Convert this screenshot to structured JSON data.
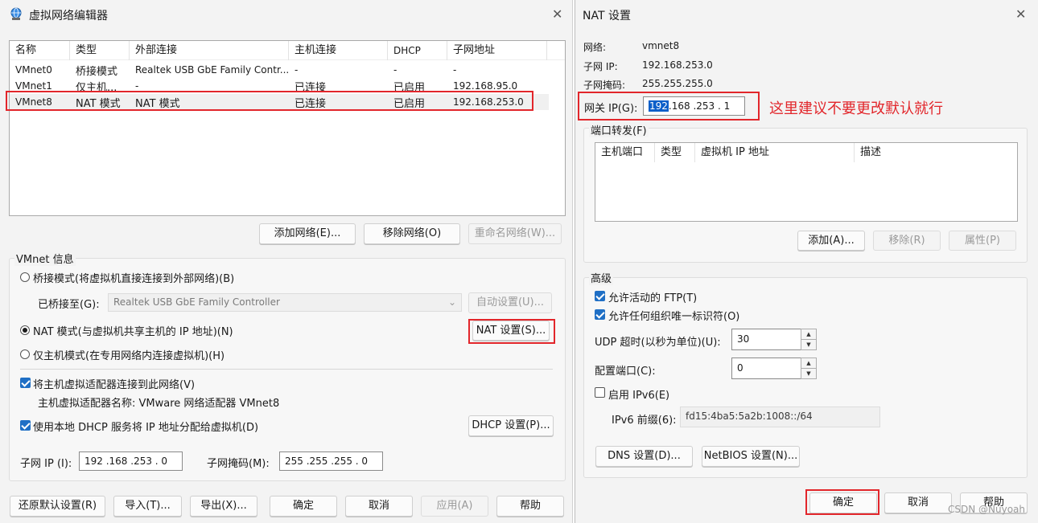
{
  "left": {
    "title": "虚拟网络编辑器",
    "columns": [
      "名称",
      "类型",
      "外部连接",
      "主机连接",
      "DHCP",
      "子网地址"
    ],
    "rows": [
      [
        "VMnet0",
        "桥接模式",
        "Realtek USB GbE Family Contr...",
        "-",
        "-",
        "-"
      ],
      [
        "VMnet1",
        "仅主机...",
        "-",
        "已连接",
        "已启用",
        "192.168.95.0"
      ],
      [
        "VMnet8",
        "NAT 模式",
        "NAT 模式",
        "已连接",
        "已启用",
        "192.168.253.0"
      ]
    ],
    "buttons": {
      "add_network": "添加网络(E)...",
      "remove_network": "移除网络(O)",
      "rename_network": "重命名网络(W)..."
    },
    "info_group": "VMnet 信息",
    "bridged_radio": "桥接模式(将虚拟机直接连接到外部网络)(B)",
    "bridged_to_label": "已桥接至(G):",
    "bridged_to_value": "Realtek USB GbE Family Controller",
    "auto_settings": "自动设置(U)...",
    "nat_radio": "NAT 模式(与虚拟机共享主机的 IP 地址)(N)",
    "nat_settings": "NAT 设置(S)...",
    "hostonly_radio": "仅主机模式(在专用网络内连接虚拟机)(H)",
    "connect_adapter": "将主机虚拟适配器连接到此网络(V)",
    "adapter_name": "主机虚拟适配器名称: VMware 网络适配器 VMnet8",
    "use_dhcp": "使用本地 DHCP 服务将 IP 地址分配给虚拟机(D)",
    "dhcp_settings": "DHCP 设置(P)...",
    "subnet_ip_label": "子网 IP (I):",
    "subnet_ip_value": "192 .168 .253 .  0",
    "subnet_mask_label": "子网掩码(M):",
    "subnet_mask_value": "255 .255 .255 .  0",
    "footer": {
      "restore": "还原默认设置(R)",
      "import": "导入(T)...",
      "export": "导出(X)...",
      "ok": "确定",
      "cancel": "取消",
      "apply": "应用(A)",
      "help": "帮助"
    }
  },
  "right": {
    "title": "NAT 设置",
    "network_label": "网络:",
    "network_value": "vmnet8",
    "subnet_ip_label": "子网 IP:",
    "subnet_ip_value": "192.168.253.0",
    "subnet_mask_label": "子网掩码:",
    "subnet_mask_value": "255.255.255.0",
    "gateway_label": "网关 IP(G):",
    "gateway_sel": "192",
    "gateway_rest": ".168 .253 .  1",
    "annotation": "这里建议不要更改默认就行",
    "port_forward_group": "端口转发(F)",
    "pf_columns": [
      "主机端口",
      "类型",
      "虚拟机 IP 地址",
      "描述"
    ],
    "pf_buttons": {
      "add": "添加(A)...",
      "remove": "移除(R)",
      "props": "属性(P)"
    },
    "advanced_group": "高级",
    "allow_ftp": "允许活动的 FTP(T)",
    "allow_uuid": "允许任何组织唯一标识符(O)",
    "udp_timeout_label": "UDP 超时(以秒为单位)(U):",
    "udp_timeout_value": "30",
    "config_port_label": "配置端口(C):",
    "config_port_value": "0",
    "enable_ipv6": "启用 IPv6(E)",
    "ipv6_prefix_label": "IPv6 前缀(6):",
    "ipv6_prefix_value": "fd15:4ba5:5a2b:1008::/64",
    "dns_settings": "DNS 设置(D)...",
    "netbios_settings": "NetBIOS 设置(N)...",
    "ok": "确定",
    "cancel": "取消",
    "help": "帮助",
    "watermark": "CSDN @Nuyoah"
  },
  "colors": {
    "highlight_box": "#e2262b",
    "check_blue": "#1f6fc5",
    "annotation_red": "#e2262b"
  },
  "icons": [
    "network-globe-icon",
    "close-icon",
    "chevron-down-icon",
    "spin-up-icon",
    "spin-down-icon"
  ]
}
